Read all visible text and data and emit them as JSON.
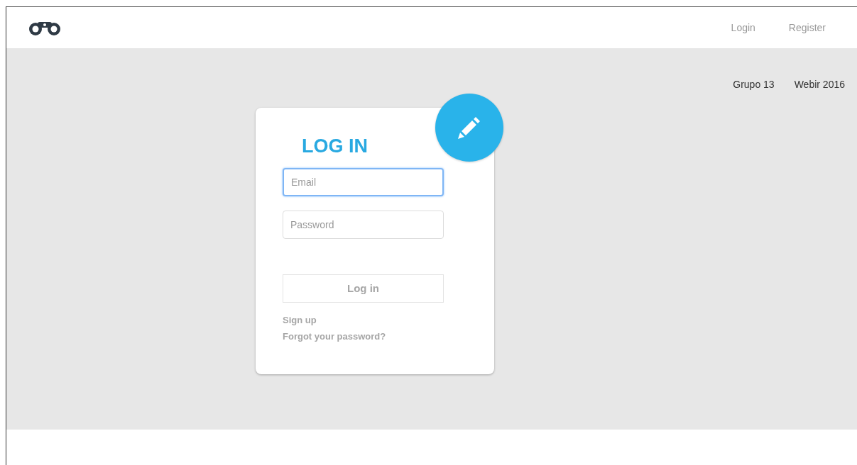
{
  "nav": {
    "links": [
      {
        "label": "Login"
      },
      {
        "label": "Register"
      }
    ]
  },
  "subnav": [
    "Grupo 13",
    "Webir 2016"
  ],
  "card": {
    "title": "LOG IN",
    "fields": [
      {
        "placeholder": "Email",
        "focused": true
      },
      {
        "placeholder": "Password",
        "focused": false
      }
    ],
    "submit": {
      "label": "Log in",
      "disabled": true
    },
    "links": [
      "Sign up",
      "Forgot your password?"
    ]
  }
}
